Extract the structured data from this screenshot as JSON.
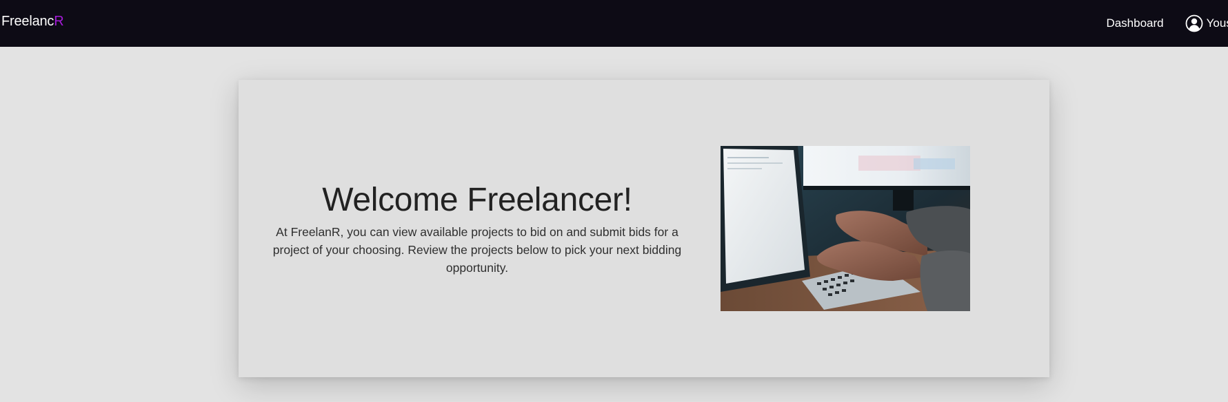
{
  "brand": {
    "name_main": "Freelanc",
    "name_accent": "R",
    "accent_color": "#a41bd8"
  },
  "nav": {
    "dashboard_label": "Dashboard",
    "user_name": "Yousef",
    "user_icon": "user-circle-icon"
  },
  "hero": {
    "title": "Welcome Freelancer!",
    "body": "At FreelanR, you can view available projects to bid on and submit bids for a project of your choosing. Review the projects below to pick your next bidding opportunity.",
    "image_subject": "hands-typing-on-laptop"
  },
  "colors": {
    "navbar_bg": "#0d0b15",
    "page_bg": "#e3e3e3",
    "card_bg": "#dfdfdf"
  }
}
